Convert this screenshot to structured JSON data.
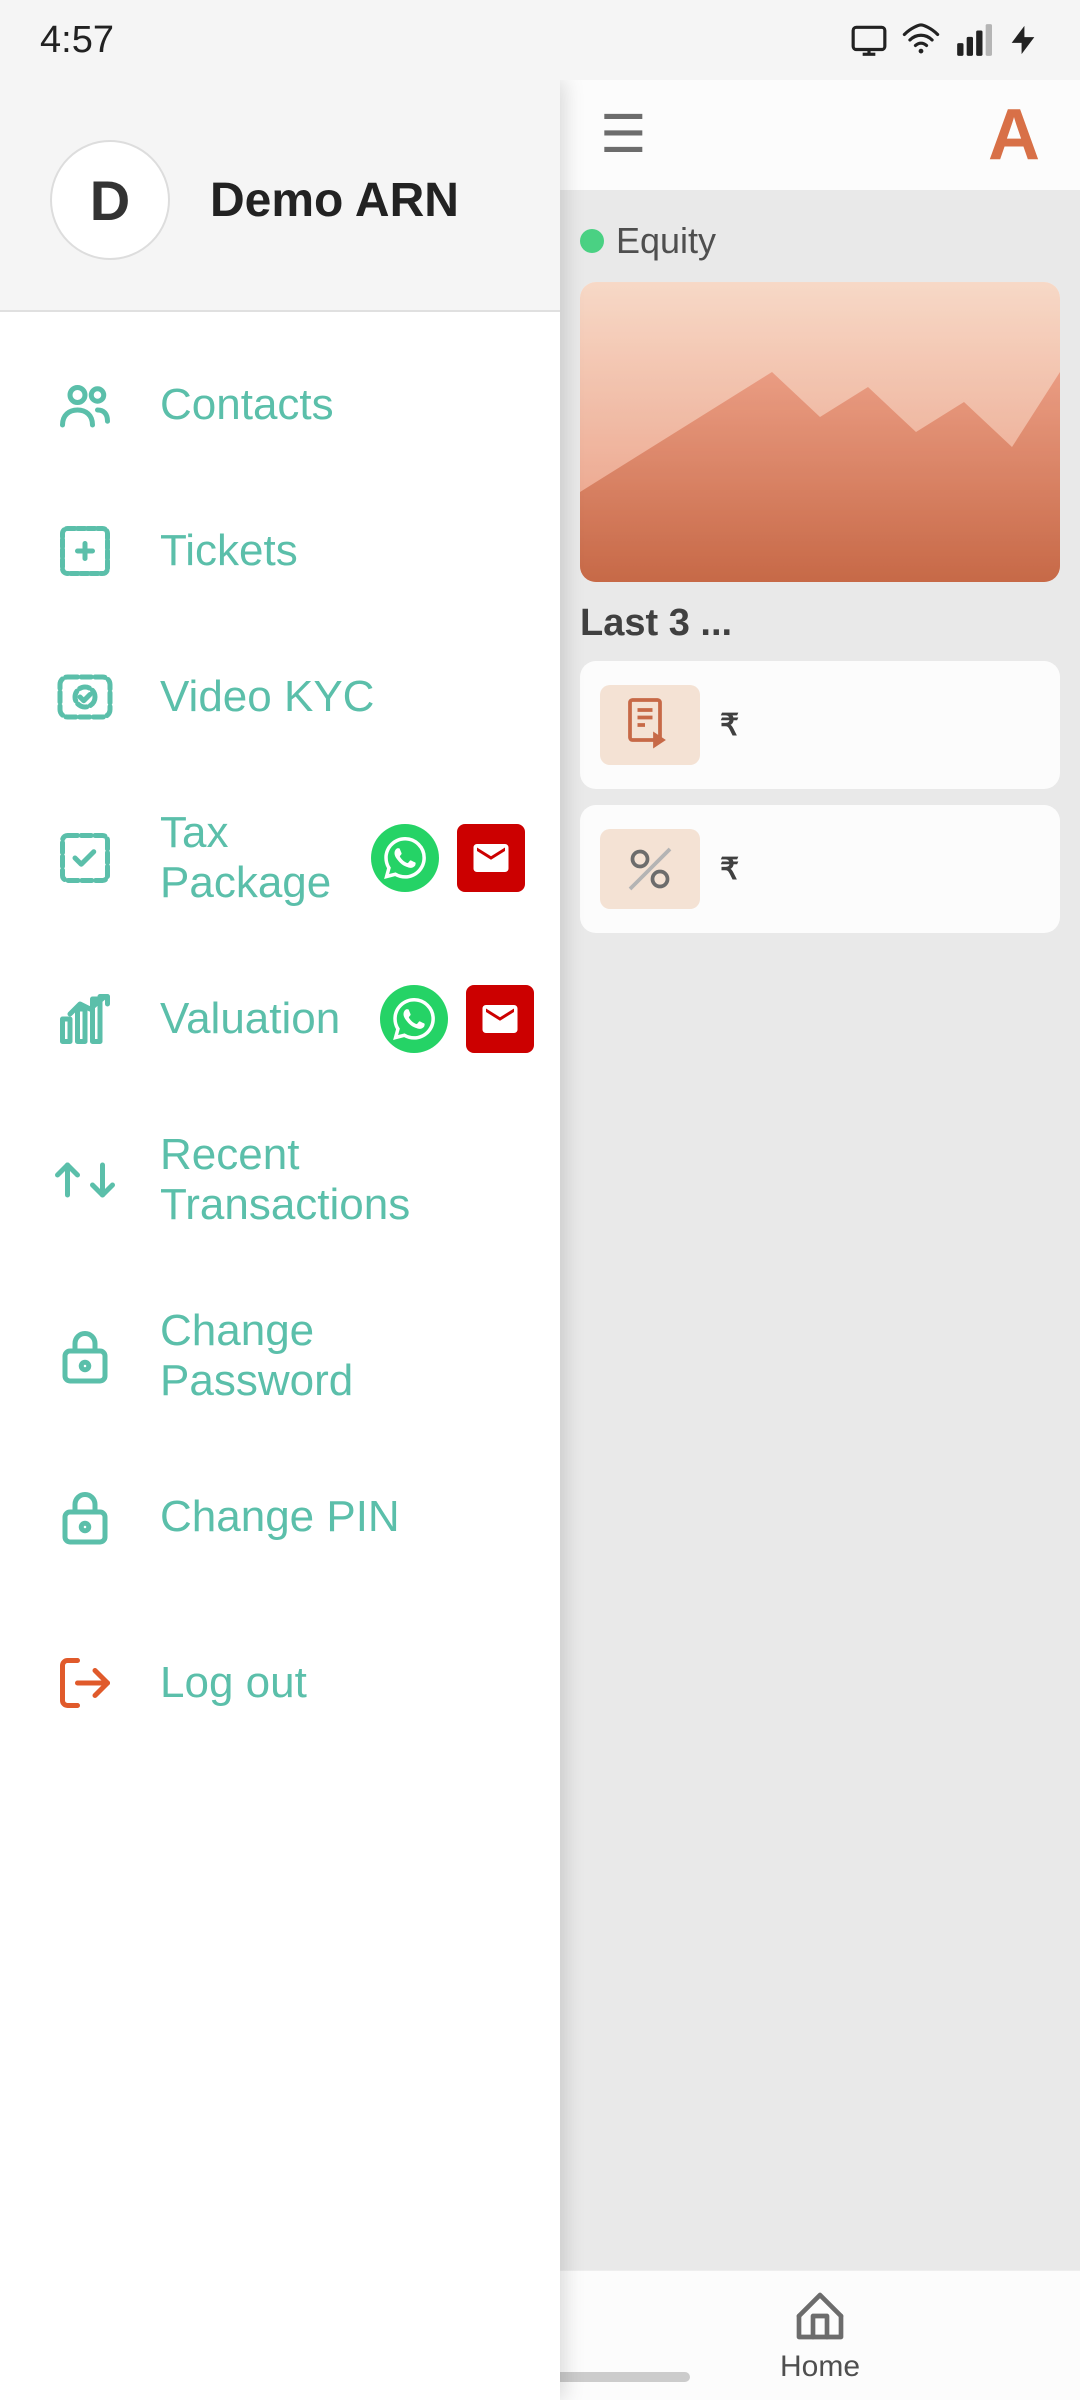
{
  "status_bar": {
    "time": "4:57",
    "icons": [
      "screen-icon",
      "wifi-icon",
      "signal-icon",
      "battery-icon"
    ]
  },
  "profile": {
    "initial": "D",
    "name": "Demo ARN"
  },
  "menu": {
    "items": [
      {
        "id": "contacts",
        "label": "Contacts",
        "icon": "contacts-icon",
        "has_actions": false
      },
      {
        "id": "tickets",
        "label": "Tickets",
        "icon": "tickets-icon",
        "has_actions": false
      },
      {
        "id": "video-kyc",
        "label": "Video KYC",
        "icon": "video-kyc-icon",
        "has_actions": false
      },
      {
        "id": "tax-package",
        "label": "Tax Package",
        "icon": "tax-package-icon",
        "has_actions": true
      },
      {
        "id": "valuation",
        "label": "Valuation",
        "icon": "valuation-icon",
        "has_actions": true
      },
      {
        "id": "recent-transactions",
        "label": "Recent Transactions",
        "icon": "transactions-icon",
        "has_actions": false
      },
      {
        "id": "change-password",
        "label": "Change Password",
        "icon": "change-password-icon",
        "has_actions": false
      },
      {
        "id": "change-pin",
        "label": "Change PIN",
        "icon": "change-pin-icon",
        "has_actions": false
      }
    ],
    "logout": {
      "label": "Log out",
      "icon": "logout-icon"
    }
  },
  "right_panel": {
    "app_title_partial": "A",
    "equity_label": "Equity",
    "last3_label": "Last 3 ...",
    "home_tab": "Home"
  },
  "gesture_bar": {}
}
